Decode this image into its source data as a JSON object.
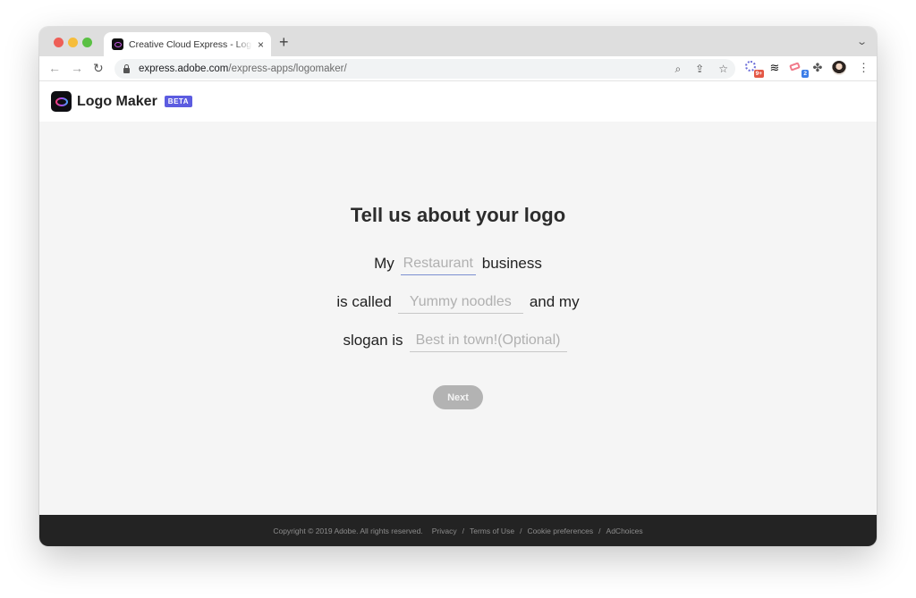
{
  "browser": {
    "tab": {
      "title": "Creative Cloud Express - Logo Maker",
      "close_icon": "×"
    },
    "new_tab_icon": "+",
    "tab_menu_icon": "⌄",
    "nav": {
      "back_icon": "←",
      "forward_icon": "→",
      "reload_icon": "↻"
    },
    "url": {
      "host": "express.adobe.com",
      "path": "/express-apps/logomaker/"
    },
    "omnibox_icons": [
      "zoom-icon",
      "share-icon",
      "bookmark-star-icon"
    ],
    "omnibox_glyphs": {
      "zoom": "⌕",
      "share": "⇪",
      "star": "☆"
    },
    "extensions": [
      {
        "name": "extension-1",
        "badge": "9+",
        "badge_color": "#e45745"
      },
      {
        "name": "buffer-extension",
        "glyph": "≋"
      },
      {
        "name": "extension-3",
        "badge": "2",
        "badge_color": "#3b7de8"
      },
      {
        "name": "extensions-puzzle",
        "glyph": "✤"
      }
    ],
    "menu_glyph": "⋮"
  },
  "app": {
    "name": "Logo Maker",
    "badge": "BETA",
    "accent": "#5c5ce0"
  },
  "form": {
    "heading": "Tell us about your logo",
    "line1": {
      "prefix": "My",
      "suffix": "business",
      "placeholder": "Restaurant",
      "value": ""
    },
    "line2": {
      "prefix": "is called",
      "suffix": "and my",
      "placeholder": "Yummy noodles",
      "value": ""
    },
    "line3": {
      "prefix": "slogan is",
      "placeholder": "Best in town!(Optional)",
      "value": ""
    },
    "next_label": "Next"
  },
  "footer": {
    "copyright": "Copyright © 2019 Adobe. All rights reserved.",
    "links": [
      "Privacy",
      "Terms of Use",
      "Cookie preferences",
      "AdChoices"
    ],
    "separator": "/"
  }
}
